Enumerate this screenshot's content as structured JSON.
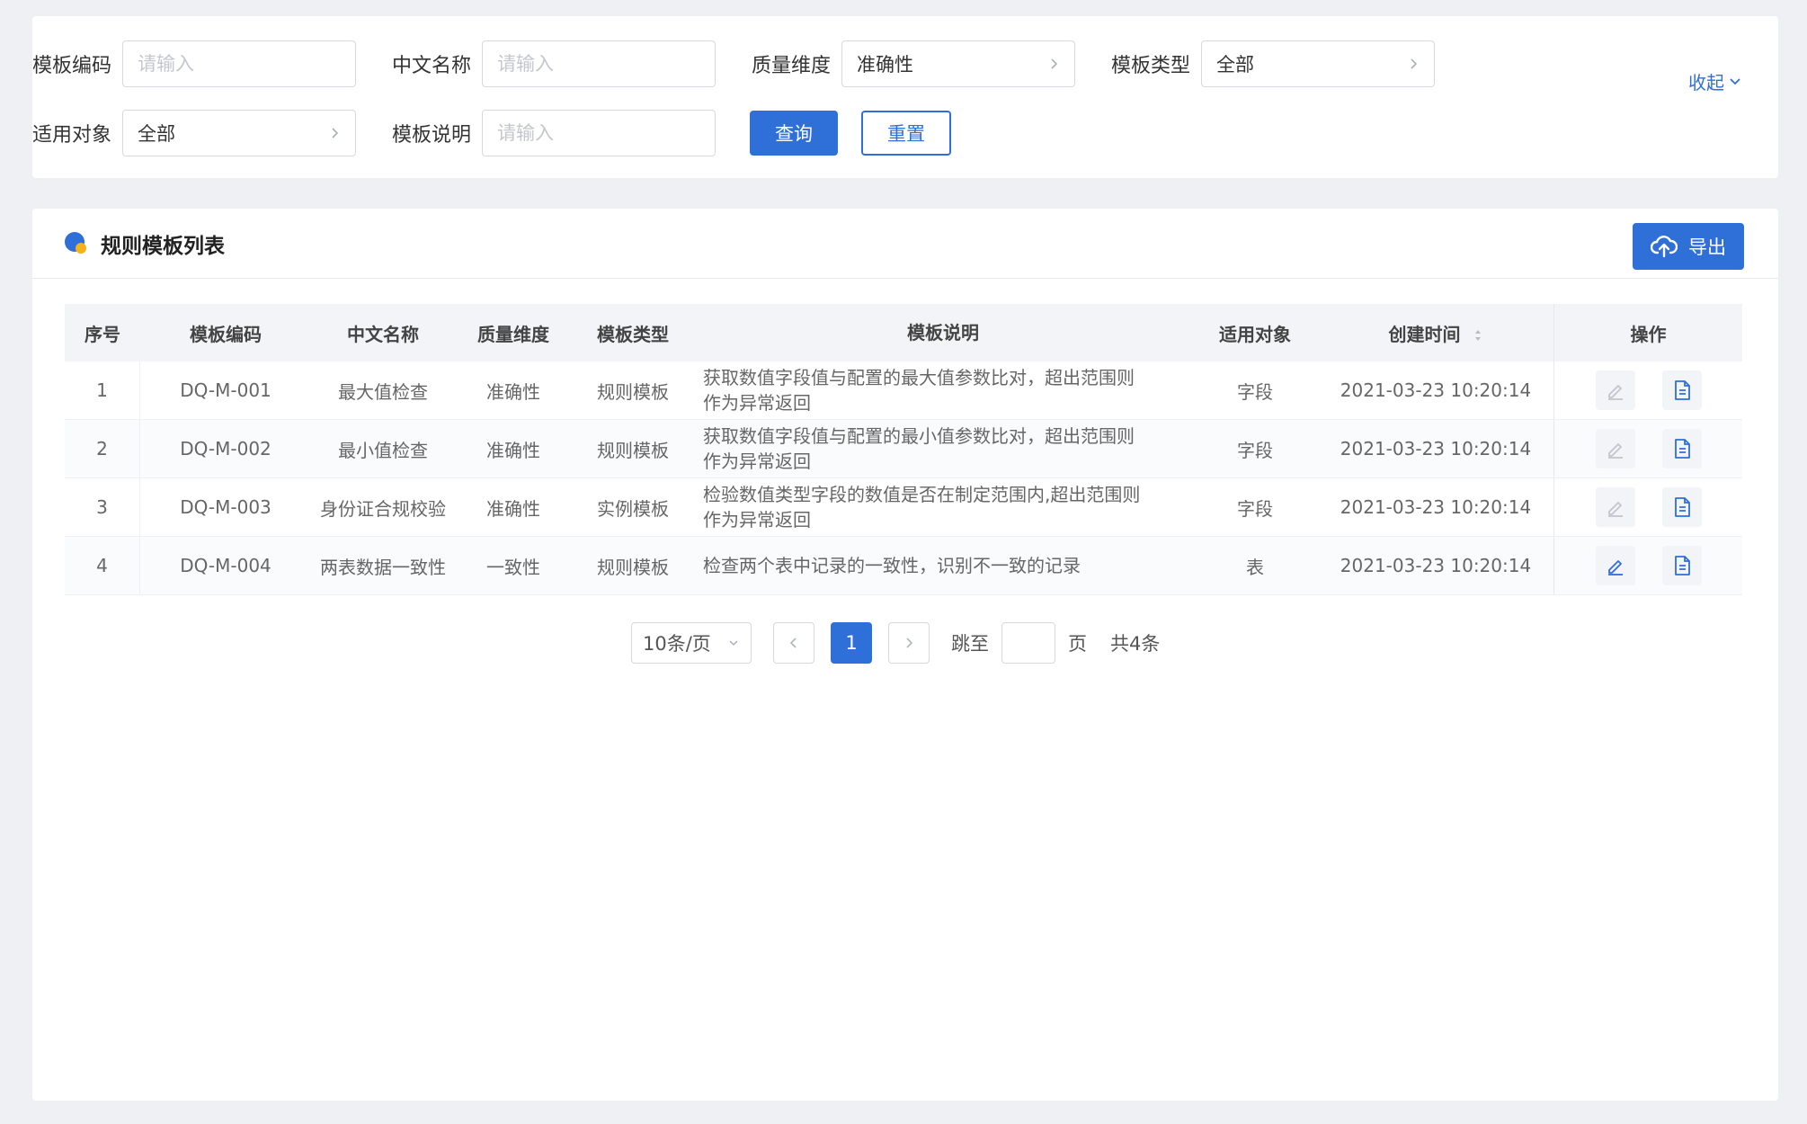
{
  "filters": {
    "template_code": {
      "label": "模板编码",
      "placeholder": "请输入",
      "value": ""
    },
    "chinese_name": {
      "label": "中文名称",
      "placeholder": "请输入",
      "value": ""
    },
    "quality_dimension": {
      "label": "质量维度",
      "value": "准确性"
    },
    "template_type": {
      "label": "模板类型",
      "value": "全部"
    },
    "applicable_object": {
      "label": "适用对象",
      "value": "全部"
    },
    "template_desc": {
      "label": "模板说明",
      "placeholder": "请输入",
      "value": ""
    },
    "query_label": "查询",
    "reset_label": "重置",
    "collapse_label": "收起"
  },
  "list": {
    "title": "规则模板列表",
    "export_label": "导出",
    "columns": [
      "序号",
      "模板编码",
      "中文名称",
      "质量维度",
      "模板类型",
      "模板说明",
      "适用对象",
      "创建时间",
      "操作"
    ],
    "rows": [
      {
        "no": "1",
        "code": "DQ-M-001",
        "name": "最大值检查",
        "dimension": "准确性",
        "type": "规则模板",
        "desc_line1": "获取数值字段值与配置的最大值参数比对，超出范围则",
        "desc_line2": "作为异常返回",
        "object": "字段",
        "time": "2021-03-23 10:20:14"
      },
      {
        "no": "2",
        "code": "DQ-M-002",
        "name": "最小值检查",
        "dimension": "准确性",
        "type": "规则模板",
        "desc_line1": "获取数值字段值与配置的最小值参数比对，超出范围则",
        "desc_line2": "作为异常返回",
        "object": "字段",
        "time": "2021-03-23 10:20:14"
      },
      {
        "no": "3",
        "code": "DQ-M-003",
        "name": "身份证合规校验",
        "dimension": "准确性",
        "type": "实例模板",
        "desc_line1": "检验数值类型字段的数值是否在制定范围内,超出范围则",
        "desc_line2": "作为异常返回",
        "object": "字段",
        "time": "2021-03-23 10:20:14"
      },
      {
        "no": "4",
        "code": "DQ-M-004",
        "name": "两表数据一致性",
        "dimension": "一致性",
        "type": "规则模板",
        "desc_line1": "检查两个表中记录的一致性，识别不一致的记录",
        "desc_line2": "",
        "object": "表",
        "time": "2021-03-23 10:20:14"
      }
    ]
  },
  "pagination": {
    "page_size": "10条/页",
    "current_page": "1",
    "jump_label": "跳至",
    "page_suffix": "页",
    "total": "共4条"
  },
  "colors": {
    "primary": "#2f6fd8",
    "accent_yellow": "#f5b21b",
    "disabled_icon": "#c2c6cc"
  },
  "icons": {
    "edit": "pencil-icon",
    "detail": "document-icon",
    "export": "cloud-upload-icon",
    "sort": "sort-icon"
  }
}
